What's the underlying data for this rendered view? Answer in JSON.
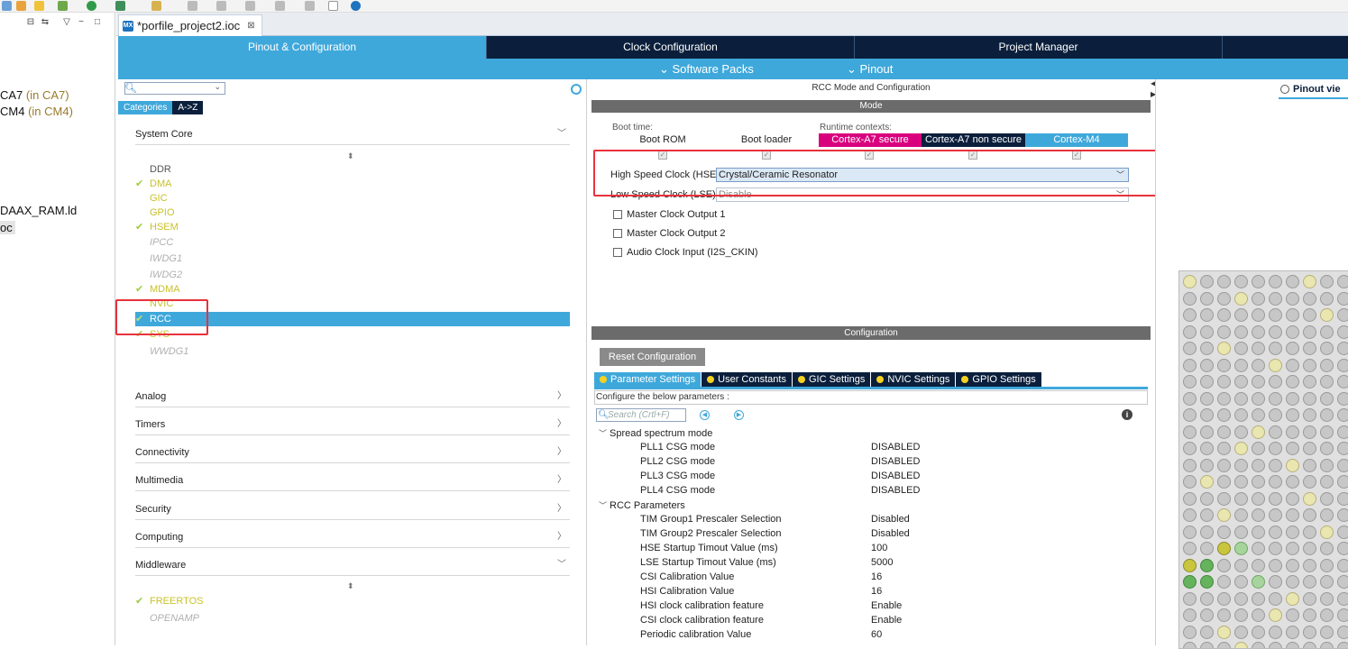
{
  "project_tree": {
    "lines": [
      {
        "main": "CA7",
        "sub": " (in CA7)"
      },
      {
        "main": "CM4",
        "sub": " (in CM4)"
      },
      {
        "main": "DAAX_RAM.ld",
        "sub": ""
      },
      {
        "main": "oc",
        "sub": ""
      }
    ]
  },
  "editor_tab": {
    "label": "*porfile_project2.ioc",
    "close": "⊠",
    "icon": "MX"
  },
  "main_tabs": [
    "Pinout & Configuration",
    "Clock Configuration",
    "Project Manager"
  ],
  "sub_bar": [
    "Software Packs",
    "Pinout"
  ],
  "categories": {
    "tabs": [
      "Categories",
      "A->Z"
    ],
    "groups": {
      "system_core": "System Core",
      "analog": "Analog",
      "timers": "Timers",
      "connectivity": "Connectivity",
      "multimedia": "Multimedia",
      "security": "Security",
      "computing": "Computing",
      "middleware": "Middleware"
    },
    "system_core_items": [
      {
        "label": "DDR",
        "state": "plain"
      },
      {
        "label": "DMA",
        "state": "en"
      },
      {
        "label": "GIC",
        "state": "en-nocheck"
      },
      {
        "label": "GPIO",
        "state": "en-nocheck"
      },
      {
        "label": "HSEM",
        "state": "en"
      },
      {
        "label": "IPCC",
        "state": "dis"
      },
      {
        "label": "IWDG1",
        "state": "dis"
      },
      {
        "label": "IWDG2",
        "state": "dis"
      },
      {
        "label": "MDMA",
        "state": "en"
      },
      {
        "label": "NVIC",
        "state": "en-nocheck"
      },
      {
        "label": "RCC",
        "state": "sel"
      },
      {
        "label": "SYS",
        "state": "en"
      },
      {
        "label": "WWDG1",
        "state": "dis"
      }
    ],
    "middleware_items": [
      {
        "label": "FREERTOS",
        "state": "en"
      },
      {
        "label": "OPENAMP",
        "state": "dis"
      }
    ]
  },
  "mode": {
    "title": "RCC Mode and Configuration",
    "bar": "Mode",
    "boot_time_label": "Boot time:",
    "runtime_label": "Runtime contexts:",
    "contexts": [
      "Boot ROM",
      "Boot loader",
      "Cortex-A7 secure",
      "Cortex-A7 non secure",
      "Cortex-M4"
    ],
    "hse_label": "High Speed Clock (HSE)",
    "hse_value": "Crystal/Ceramic Resonator",
    "lse_label": "Low Speed Clock (LSE)",
    "lse_value": "Disable",
    "options": [
      "Master Clock Output 1",
      "Master Clock Output 2",
      "Audio Clock Input (I2S_CKIN)"
    ]
  },
  "configuration": {
    "bar": "Configuration",
    "reset_label": "Reset Configuration",
    "tabs": [
      "Parameter Settings",
      "User Constants",
      "GIC Settings",
      "NVIC Settings",
      "GPIO Settings"
    ],
    "hint": "Configure the below parameters :",
    "search_placeholder": "Search (Crtl+F)",
    "groups": [
      {
        "name": "Spread spectrum mode",
        "rows": [
          {
            "k": "PLL1 CSG mode",
            "v": "DISABLED"
          },
          {
            "k": "PLL2 CSG mode",
            "v": "DISABLED"
          },
          {
            "k": "PLL3 CSG mode",
            "v": "DISABLED"
          },
          {
            "k": "PLL4 CSG mode",
            "v": "DISABLED"
          }
        ]
      },
      {
        "name": "RCC Parameters",
        "rows": [
          {
            "k": "TIM Group1 Prescaler Selection",
            "v": "Disabled"
          },
          {
            "k": "TIM Group2 Prescaler Selection",
            "v": "Disabled"
          },
          {
            "k": "HSE Startup Timout Value (ms)",
            "v": "100"
          },
          {
            "k": "LSE Startup Timout Value (ms)",
            "v": "5000"
          },
          {
            "k": "CSI Calibration Value",
            "v": "16"
          },
          {
            "k": "HSI Calibration Value",
            "v": "16"
          },
          {
            "k": "HSI clock calibration feature",
            "v": "Enable"
          },
          {
            "k": "CSI clock calibration feature",
            "v": "Enable"
          },
          {
            "k": "Periodic calibration Value",
            "v": "60"
          }
        ]
      }
    ]
  },
  "pinout": {
    "view_tab": "Pinout vie"
  },
  "colors": {
    "accent": "#3fa8db",
    "navy": "#0b1f3c",
    "magenta": "#d9007e",
    "enabled": "#c8c12a",
    "highlight": "#e8323c"
  }
}
